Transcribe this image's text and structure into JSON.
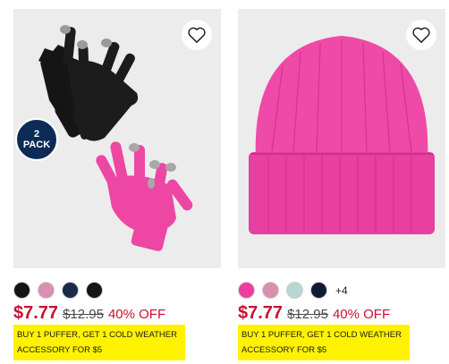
{
  "products": [
    {
      "badge": {
        "line1": "2",
        "line2": "PACK"
      },
      "favorite_icon": "heart-outline-icon",
      "swatches": [
        "#141414",
        "#d88fb0",
        "#1b2a48",
        "#141414"
      ],
      "more_colors": "",
      "price": "$7.77",
      "original_price": "$12.95",
      "discount": "40% OFF",
      "promo": "BUY 1 PUFFER, GET 1 COLD WEATHER ACCESSORY FOR $5"
    },
    {
      "favorite_icon": "heart-outline-icon",
      "swatches": [
        "#ee3d9e",
        "#d88fb0",
        "#b9d6d3",
        "#101a33"
      ],
      "more_colors": "+4",
      "price": "$7.77",
      "original_price": "$12.95",
      "discount": "40% OFF",
      "promo": "BUY 1 PUFFER, GET 1 COLD WEATHER ACCESSORY FOR $5"
    }
  ],
  "colors": {
    "price": "#c8102e",
    "promo_bg": "#fff200",
    "badge_bg": "#0d2b57"
  }
}
